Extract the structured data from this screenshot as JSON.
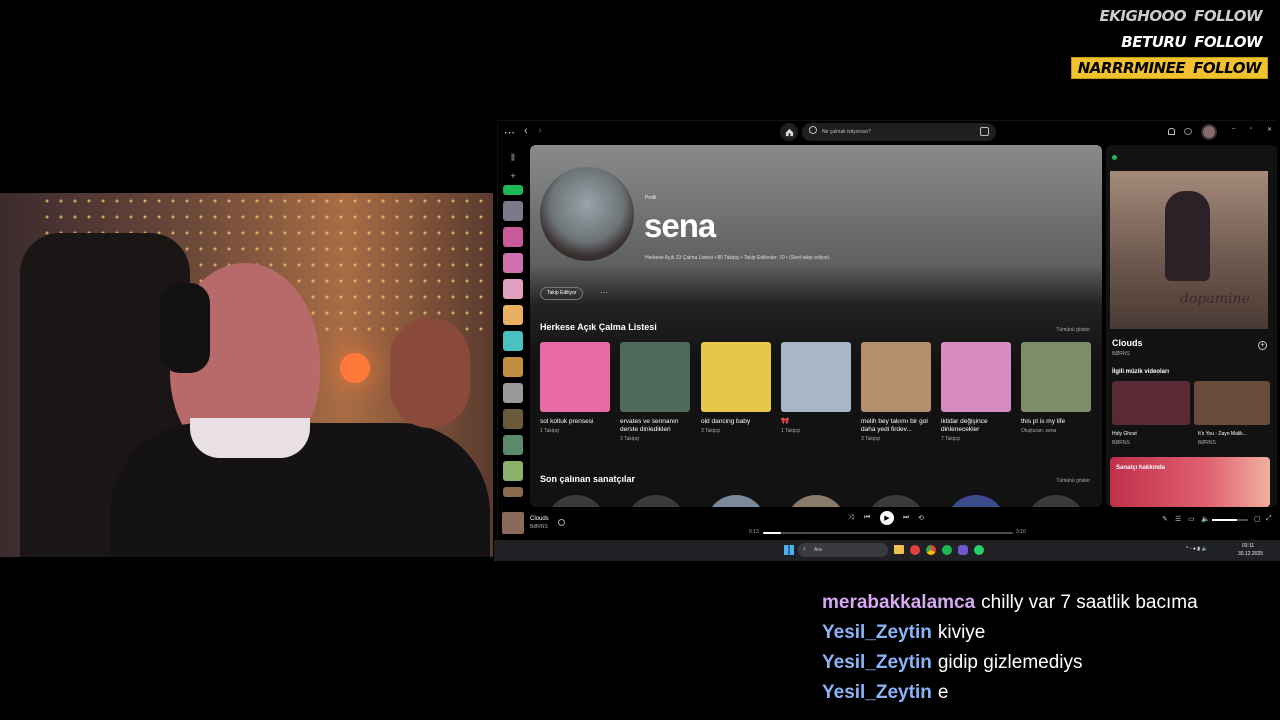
{
  "alerts": [
    {
      "name": "EKIGHOOO",
      "action": "FOLLOW",
      "bg": "#000000",
      "fg": "#cccccc"
    },
    {
      "name": "BETURU",
      "action": "FOLLOW",
      "bg": "#000000",
      "fg": "#ffffff"
    },
    {
      "name": "NARRRMINEE",
      "action": "FOLLOW",
      "bg": "#f2c12e",
      "fg": "#000000"
    }
  ],
  "spotify": {
    "search_placeholder": "Ne çalmak istiyorsun?",
    "profile": {
      "label": "Profil",
      "name": "sena",
      "stats": "Herkese Açık 23 Çalma Listesi • 85 Takipçi • Takip Edilenler: 70 • (Seni takip ediyor)",
      "following_button": "Takip Ediliyor",
      "more": "···"
    },
    "playlists_section": {
      "title": "Herkese Açık Çalma Listesi",
      "show_all": "Tümünü göster",
      "items": [
        {
          "title": "sol koltuk prensesi",
          "sub": "1 Takipçi",
          "color": "#e86aa6"
        },
        {
          "title": "ervates ve sennanın derste dinledikleri",
          "sub": "3 Takipçi",
          "color": "#4f6a5a"
        },
        {
          "title": "old dancing baby",
          "sub": "3 Takipçi",
          "color": "#e8c64a"
        },
        {
          "title": "🎀",
          "sub": "1 Takipçi",
          "color": "#a9b6c8"
        },
        {
          "title": "melih bey takımı bir gol daha yedi firdev...",
          "sub": "3 Takipçi",
          "color": "#b58e6e"
        },
        {
          "title": "iktidar değişince dinlenecekler",
          "sub": "7 Takipçi",
          "color": "#d68cc0"
        },
        {
          "title": "this pl is my life",
          "sub": "Oluşturan: sena",
          "color": "#7c8d6a"
        }
      ]
    },
    "artists_section": {
      "title": "Son çalınan sanatçılar",
      "show_all": "Tümünü göster"
    },
    "now_playing_panel": {
      "album_text": "dopamine",
      "track": "Clouds",
      "artist": "BØRNS",
      "videos_title": "İlgili müzik videoları",
      "videos": [
        {
          "title": "Holy Ghost",
          "artist": "BØRNS"
        },
        {
          "title": "It's You - Zayn Malik...",
          "artist": "BØRNS"
        }
      ],
      "about_artist": "Sanatçı hakkında"
    },
    "player": {
      "track": "Clouds",
      "artist": "BØRNS",
      "elapsed": "0:13",
      "duration": "3:10",
      "progress": 0.07,
      "volume": 0.7
    }
  },
  "taskbar": {
    "search": "Ara",
    "time": "03:11",
    "date": "30.12.2025"
  },
  "chat": [
    {
      "user": "merabakkalamca",
      "color": "#d6a7f2",
      "message": "chilly var 7 saatlik bacıma"
    },
    {
      "user": "Yesil_Zeytin",
      "color": "#8ab4f8",
      "message": "kiviye"
    },
    {
      "user": "Yesil_Zeytin",
      "color": "#8ab4f8",
      "message": "gidip gizlemediys"
    },
    {
      "user": "Yesil_Zeytin",
      "color": "#8ab4f8",
      "message": "e"
    }
  ]
}
